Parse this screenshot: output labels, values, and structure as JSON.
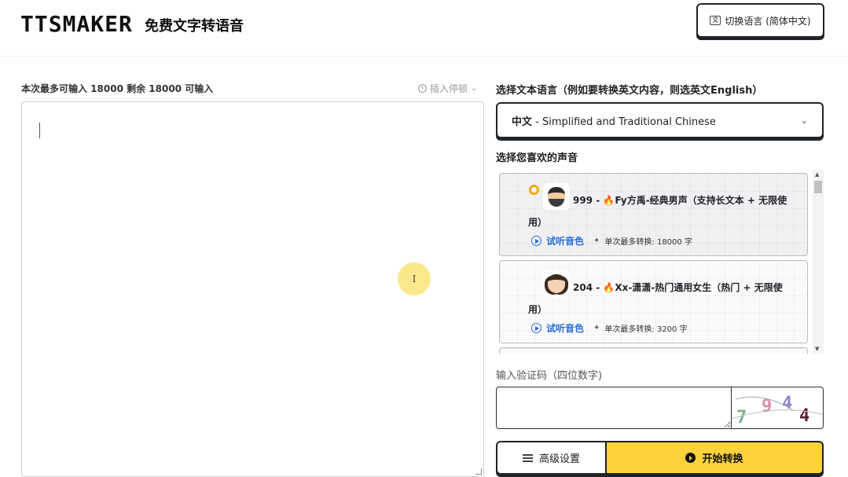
{
  "header": {
    "logo": "TTSMAKER",
    "subtitle": "免费文字转语音",
    "lang_switch_label": "切换语言 (简体中文)"
  },
  "editor": {
    "limit_label": "本次最多可输入 18000 剩余 18000 可输入",
    "insert_pause_label": "插入停顿",
    "text_value": ""
  },
  "language": {
    "label": "选择文本语言（例如要转换英文内容，则选英文English）",
    "selected_prefix": "中文",
    "selected_suffix": " - Simplified and Traditional Chinese"
  },
  "voices": {
    "label": "选择您喜欢的声音",
    "items": [
      {
        "title": "999 - 🔥Fy方禹-经典男声（支持长文本 + 无限使用）",
        "try_label": "试听音色",
        "max_label": "单次最多转换: 18000 字",
        "selected": true,
        "avatar": "man-avatar"
      },
      {
        "title": "204 - 🔥Xx-潇潇-热门通用女生（热门 + 无限使用）",
        "try_label": "试听音色",
        "max_label": "单次最多转换: 3200 字",
        "selected": false,
        "avatar": "woman-avatar"
      }
    ]
  },
  "captcha": {
    "label": "输入验证码（四位数字)",
    "value": "",
    "image_digits": [
      "7",
      "9",
      "4",
      "4"
    ]
  },
  "actions": {
    "advanced_label": "高级设置",
    "start_label": "开始转换"
  },
  "colors": {
    "accent_yellow": "#fdd23c",
    "link_blue": "#2a6fdb",
    "radio_orange": "#f0a91c",
    "border_dark": "#1f2328"
  }
}
